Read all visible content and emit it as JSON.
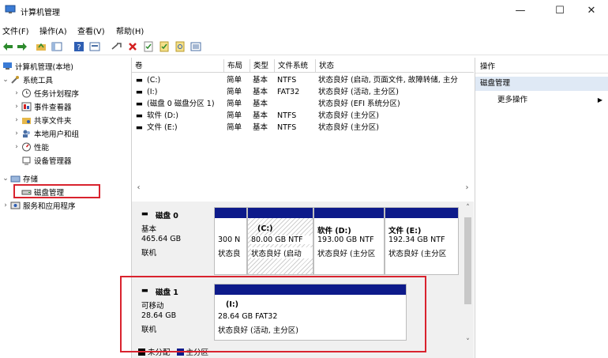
{
  "window": {
    "title": "计算机管理",
    "minimize": "—",
    "maximize": "☐",
    "close": "✕"
  },
  "menu": [
    "文件(F)",
    "操作(A)",
    "查看(V)",
    "帮助(H)"
  ],
  "tree": {
    "root": "计算机管理(本地)",
    "system_tools": "系统工具",
    "task_scheduler": "任务计划程序",
    "event_viewer": "事件查看器",
    "shared_folders": "共享文件夹",
    "local_users": "本地用户和组",
    "performance": "性能",
    "device_manager": "设备管理器",
    "storage": "存储",
    "disk_management": "磁盘管理",
    "services_apps": "服务和应用程序"
  },
  "volume_table": {
    "columns": [
      "卷",
      "布局",
      "类型",
      "文件系统",
      "状态"
    ],
    "rows": [
      [
        "(C:)",
        "简单",
        "基本",
        "NTFS",
        "状态良好 (启动, 页面文件, 故障转储, 主分"
      ],
      [
        "(I:)",
        "简单",
        "基本",
        "FAT32",
        "状态良好 (活动, 主分区)"
      ],
      [
        "(磁盘 0 磁盘分区 1)",
        "简单",
        "基本",
        "",
        "状态良好 (EFI 系统分区)"
      ],
      [
        "软件 (D:)",
        "简单",
        "基本",
        "NTFS",
        "状态良好 (主分区)"
      ],
      [
        "文件 (E:)",
        "简单",
        "基本",
        "NTFS",
        "状态良好 (主分区)"
      ]
    ]
  },
  "disks": [
    {
      "name": "磁盘 0",
      "type": "基本",
      "size": "465.64 GB",
      "status": "联机",
      "partitions": [
        {
          "label": "",
          "size": "300 N",
          "status": "状态良"
        },
        {
          "label": "(C:)",
          "size": "80.00 GB NTF",
          "status": "状态良好 (启动"
        },
        {
          "label": "软件 (D:)",
          "size": "193.00 GB NTF",
          "status": "状态良好 (主分区"
        },
        {
          "label": "文件 (E:)",
          "size": "192.34 GB NTF",
          "status": "状态良好 (主分区"
        }
      ]
    },
    {
      "name": "磁盘 1",
      "type": "可移动",
      "size": "28.64 GB",
      "status": "联机",
      "partitions": [
        {
          "label": "(I:)",
          "size": "28.64 GB FAT32",
          "status": "状态良好 (活动, 主分区)"
        }
      ]
    }
  ],
  "legend": {
    "unallocated": "未分配",
    "primary": "主分区"
  },
  "actions": {
    "header": "操作",
    "section": "磁盘管理",
    "more": "更多操作"
  },
  "colors": {
    "partition_header": "#0d1a8a",
    "highlight": "#d9232e",
    "selected": "#dfe9f5"
  }
}
